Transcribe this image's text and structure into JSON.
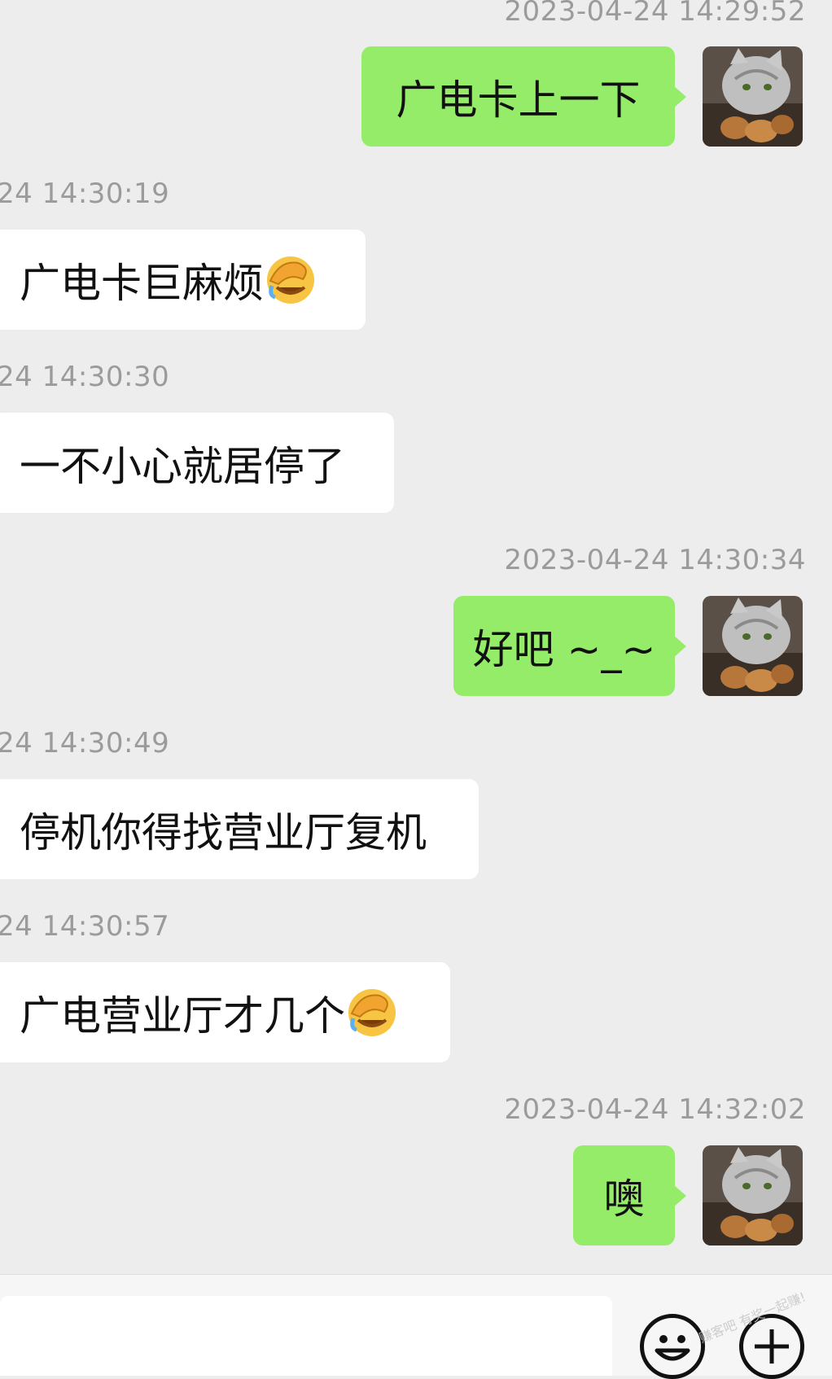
{
  "messages": [
    {
      "side": "me",
      "time": "2023-04-24 14:29:52",
      "text": "广电卡上一下"
    },
    {
      "side": "other",
      "time": "24 14:30:19",
      "text": "广电卡巨麻烦",
      "emoji": "face-palm-crying-emoji"
    },
    {
      "side": "other",
      "time": "24 14:30:30",
      "text": "一不小心就居停了"
    },
    {
      "side": "me",
      "time": "2023-04-24 14:30:34",
      "text": "好吧 ~_~"
    },
    {
      "side": "other",
      "time": "24 14:30:49",
      "text": "停机你得找营业厅复机"
    },
    {
      "side": "other",
      "time": "24 14:30:57",
      "text": "广电营业厅才几个",
      "emoji": "face-palm-crying-emoji"
    },
    {
      "side": "me",
      "time": "2023-04-24 14:32:02",
      "text": "噢"
    }
  ],
  "avatar": {
    "icon": "cat-avatar"
  },
  "input_bar": {
    "emoji_button_icon": "smiley-icon",
    "more_button_icon": "plus-icon"
  },
  "watermark": "赚客吧 有奖一起赚!",
  "colors": {
    "background": "#ededed",
    "my_bubble": "#95ec69",
    "other_bubble": "#ffffff",
    "timestamp": "#9b9b9b"
  }
}
